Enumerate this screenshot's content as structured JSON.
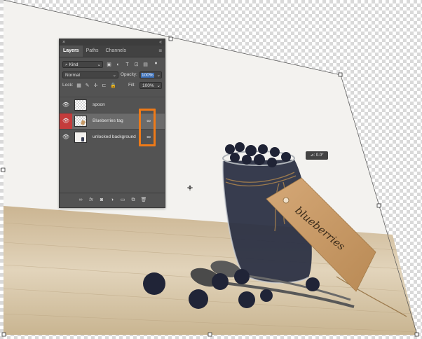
{
  "panel": {
    "close_glyph": "×",
    "collapse_glyph": "«",
    "tabs": [
      {
        "label": "Layers"
      },
      {
        "label": "Paths"
      },
      {
        "label": "Channels"
      }
    ],
    "menu_glyph": "≡",
    "filter": {
      "value": "Kind",
      "icon": "search-icon"
    },
    "blend_mode": "Normal",
    "opacity_label": "Opacity:",
    "opacity_value": "100%",
    "lock_label": "Lock:",
    "fill_label": "Fill:",
    "fill_value": "100%",
    "layers": [
      {
        "name": "spoon",
        "visible": true,
        "selected": false,
        "linked": false
      },
      {
        "name": "Blueberries tag",
        "visible": true,
        "selected": true,
        "linked": true
      },
      {
        "name": "unlocked background",
        "visible": true,
        "selected": false,
        "linked": true
      }
    ],
    "bottom_icons": [
      "link-icon",
      "fx-icon",
      "mask-icon",
      "adjustment-icon",
      "folder-icon",
      "new-layer-icon",
      "trash-icon"
    ],
    "fx_label": "fx"
  },
  "canvas": {
    "rotation_readout": "⊿: 0.0°",
    "tag_text": "blueberries"
  },
  "colors": {
    "panel_bg": "#535353",
    "highlight_box": "#ee7a18",
    "selected_eye": "#c43c3c"
  }
}
